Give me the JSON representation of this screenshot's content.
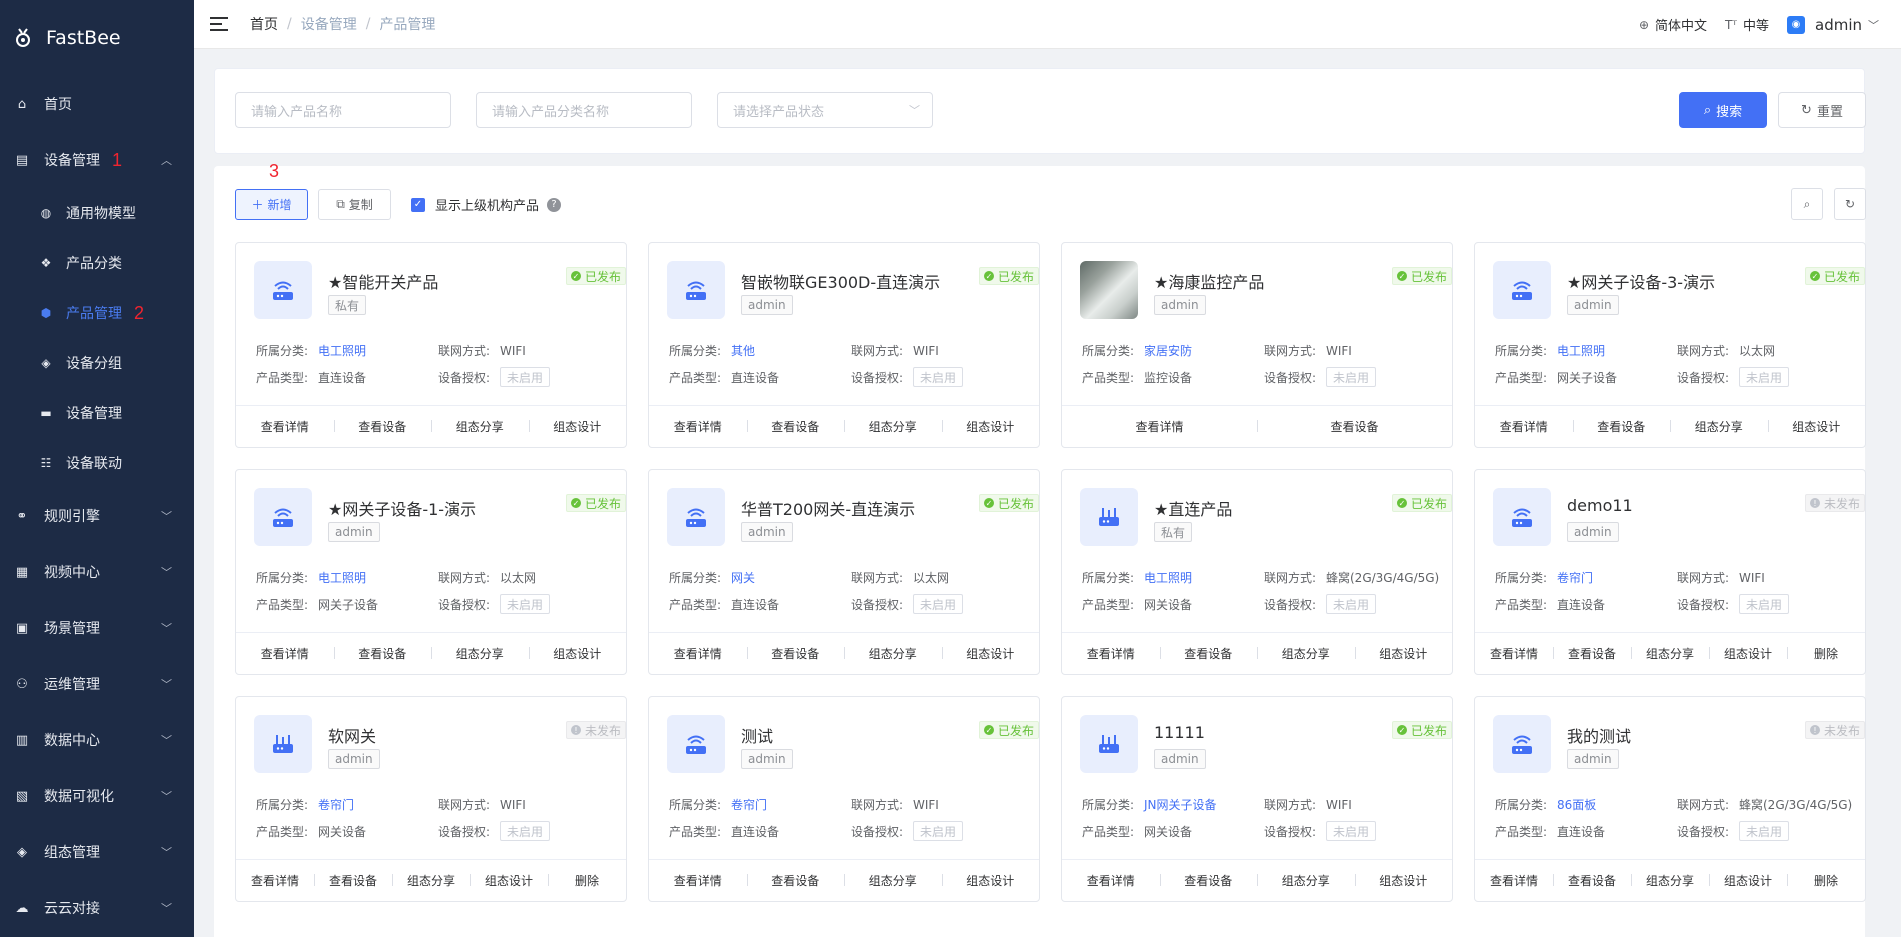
{
  "app": {
    "name": "FastBee"
  },
  "sidebar": {
    "items": [
      {
        "label": "首页",
        "icon": "home-icon",
        "glyph": "⌂"
      },
      {
        "label": "设备管理",
        "icon": "device-manage-icon",
        "glyph": "▤",
        "annotation": "1"
      },
      {
        "label": "规则引擎",
        "icon": "rule-icon",
        "glyph": "⚭"
      },
      {
        "label": "视频中心",
        "icon": "grid-icon",
        "glyph": "▦"
      },
      {
        "label": "场景管理",
        "icon": "scene-icon",
        "glyph": "▣"
      },
      {
        "label": "运维管理",
        "icon": "ops-icon",
        "glyph": "⚇"
      },
      {
        "label": "数据中心",
        "icon": "chart-icon",
        "glyph": "▥"
      },
      {
        "label": "数据可视化",
        "icon": "visual-icon",
        "glyph": "▧"
      },
      {
        "label": "组态管理",
        "icon": "layers-icon",
        "glyph": "◈"
      },
      {
        "label": "云云对接",
        "icon": "cloud-icon",
        "glyph": "☁"
      }
    ],
    "sub_items": [
      {
        "label": "通用物模型",
        "icon": "model-icon",
        "glyph": "◍"
      },
      {
        "label": "产品分类",
        "icon": "category-icon",
        "glyph": "❖"
      },
      {
        "label": "产品管理",
        "icon": "product-icon",
        "glyph": "⬢",
        "annotation": "2"
      },
      {
        "label": "设备分组",
        "icon": "group-icon",
        "glyph": "◈"
      },
      {
        "label": "设备管理",
        "icon": "device-icon",
        "glyph": "▬"
      },
      {
        "label": "设备联动",
        "icon": "linkage-icon",
        "glyph": "☷"
      }
    ]
  },
  "header": {
    "breadcrumb": [
      "首页",
      "设备管理",
      "产品管理"
    ],
    "language": "简体中文",
    "font_size": "中等",
    "user": "admin"
  },
  "search": {
    "product_name_placeholder": "请输入产品名称",
    "category_placeholder": "请输入产品分类名称",
    "status_placeholder": "请选择产品状态",
    "search_label": "搜索",
    "reset_label": "重置"
  },
  "toolbar": {
    "annotation": "3",
    "add_label": "新增",
    "copy_label": "复制",
    "show_parent_label": "显示上级机构产品"
  },
  "card_labels": {
    "category": "所属分类:",
    "network": "联网方式:",
    "product_type": "产品类型:",
    "auth": "设备授权:"
  },
  "products": [
    {
      "name": "★智能开关产品",
      "owner": "私有",
      "status": "已发布",
      "published": true,
      "category": "电工照明",
      "network": "WIFI",
      "type": "直连设备",
      "auth": "未启用",
      "thumb": "wifi",
      "actions": [
        "查看详情",
        "查看设备",
        "组态分享",
        "组态设计"
      ]
    },
    {
      "name": "智嵌物联GE300D-直连演示",
      "owner": "admin",
      "status": "已发布",
      "published": true,
      "category": "其他",
      "network": "WIFI",
      "type": "直连设备",
      "auth": "未启用",
      "thumb": "wifi",
      "actions": [
        "查看详情",
        "查看设备",
        "组态分享",
        "组态设计"
      ]
    },
    {
      "name": "★海康监控产品",
      "owner": "admin",
      "status": "已发布",
      "published": true,
      "category": "家居安防",
      "network": "WIFI",
      "type": "监控设备",
      "auth": "未启用",
      "thumb": "photo",
      "actions": [
        "查看详情",
        "查看设备"
      ]
    },
    {
      "name": "★网关子设备-3-演示",
      "owner": "admin",
      "status": "已发布",
      "published": true,
      "category": "电工照明",
      "network": "以太网",
      "type": "网关子设备",
      "auth": "未启用",
      "thumb": "wifi",
      "actions": [
        "查看详情",
        "查看设备",
        "组态分享",
        "组态设计"
      ]
    },
    {
      "name": "★网关子设备-1-演示",
      "owner": "admin",
      "status": "已发布",
      "published": true,
      "category": "电工照明",
      "network": "以太网",
      "type": "网关子设备",
      "auth": "未启用",
      "thumb": "wifi",
      "actions": [
        "查看详情",
        "查看设备",
        "组态分享",
        "组态设计"
      ]
    },
    {
      "name": "华普T200网关-直连演示",
      "owner": "admin",
      "status": "已发布",
      "published": true,
      "category": "网关",
      "network": "以太网",
      "type": "直连设备",
      "auth": "未启用",
      "thumb": "wifi",
      "actions": [
        "查看详情",
        "查看设备",
        "组态分享",
        "组态设计"
      ]
    },
    {
      "name": "★直连产品",
      "owner": "私有",
      "status": "已发布",
      "published": true,
      "category": "电工照明",
      "network": "蜂窝(2G/3G/4G/5G)",
      "type": "网关设备",
      "auth": "未启用",
      "thumb": "router",
      "actions": [
        "查看详情",
        "查看设备",
        "组态分享",
        "组态设计"
      ]
    },
    {
      "name": "demo11",
      "owner": "admin",
      "status": "未发布",
      "published": false,
      "category": "卷帘门",
      "network": "WIFI",
      "type": "直连设备",
      "auth": "未启用",
      "thumb": "wifi",
      "actions": [
        "查看详情",
        "查看设备",
        "组态分享",
        "组态设计",
        "删除"
      ]
    },
    {
      "name": "软网关",
      "owner": "admin",
      "status": "未发布",
      "published": false,
      "category": "卷帘门",
      "network": "WIFI",
      "type": "网关设备",
      "auth": "未启用",
      "thumb": "router",
      "actions": [
        "查看详情",
        "查看设备",
        "组态分享",
        "组态设计",
        "删除"
      ]
    },
    {
      "name": "测试",
      "owner": "admin",
      "status": "已发布",
      "published": true,
      "category": "卷帘门",
      "network": "WIFI",
      "type": "直连设备",
      "auth": "未启用",
      "thumb": "wifi",
      "actions": [
        "查看详情",
        "查看设备",
        "组态分享",
        "组态设计"
      ]
    },
    {
      "name": "11111",
      "owner": "admin",
      "status": "已发布",
      "published": true,
      "category": "JN网关子设备",
      "network": "WIFI",
      "type": "网关设备",
      "auth": "未启用",
      "thumb": "router",
      "actions": [
        "查看详情",
        "查看设备",
        "组态分享",
        "组态设计"
      ]
    },
    {
      "name": "我的测试",
      "owner": "admin",
      "status": "未发布",
      "published": false,
      "category": "86面板",
      "network": "蜂窝(2G/3G/4G/5G)",
      "type": "直连设备",
      "auth": "未启用",
      "thumb": "wifi",
      "actions": [
        "查看详情",
        "查看设备",
        "组态分享",
        "组态设计",
        "删除"
      ]
    }
  ],
  "colors": {
    "sidebar_bg": "#1d2b45",
    "accent": "#4370f5",
    "annotation": "#f0242f",
    "published": "#67c23a"
  }
}
